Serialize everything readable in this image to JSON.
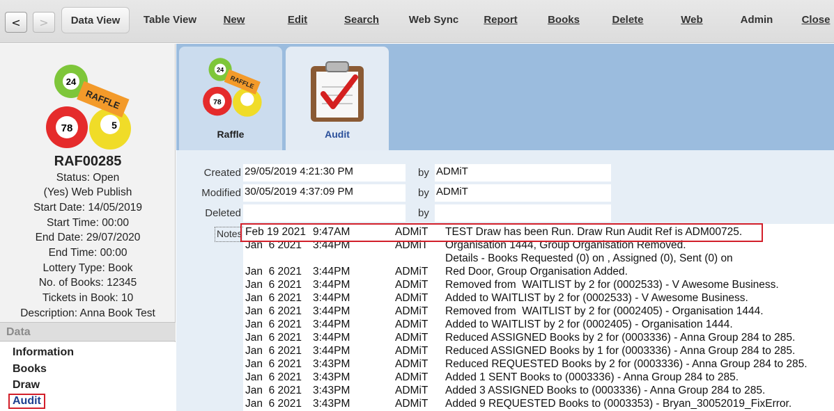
{
  "toolbar": {
    "back_label": "<",
    "forward_label": ">",
    "buttons": [
      "Data View",
      "Table View",
      "New",
      "Edit",
      "Search",
      "Web Sync",
      "Report",
      "Books",
      "Delete",
      "Web",
      "Admin",
      "Close"
    ]
  },
  "record": {
    "id": "RAF00285",
    "details": [
      "Status: Open",
      "(Yes) Web Publish",
      "Start Date: 14/05/2019",
      "Start Time: 00:00",
      "End Date: 29/07/2020",
      "End Time: 00:00",
      "Lottery Type: Book",
      "No. of Books: 12345",
      "Tickets in Book: 10",
      "Description: Anna Book Test"
    ],
    "logo_text": {
      "ball1": "24",
      "ticket": "RAFFLE",
      "ball2": "78",
      "ball3": "5"
    }
  },
  "data_section": {
    "header": "Data",
    "items": [
      "Information",
      "Books",
      "Draw",
      "Audit"
    ]
  },
  "tabs": [
    {
      "label": "Raffle",
      "icon": "raffle-icon"
    },
    {
      "label": "Audit",
      "icon": "clipboard-check-icon"
    }
  ],
  "audit": {
    "created_label": "Created",
    "created_value": "29/05/2019 4:21:30 PM",
    "created_by": "ADMiT",
    "modified_label": "Modified",
    "modified_value": "30/05/2019 4:37:09 PM",
    "modified_by": "ADMiT",
    "deleted_label": "Deleted",
    "deleted_value": "",
    "deleted_by": "",
    "by_label": "by",
    "notes_label": "Notes",
    "notes": [
      {
        "date": "Feb 19 2021",
        "time": "9:47AM",
        "user": "ADMiT",
        "msg": "TEST Draw has been Run. Draw Run Audit Ref is ADM00725."
      },
      {
        "date": "Jan  6 2021",
        "time": "3:44PM",
        "user": "ADMiT",
        "msg": "Organisation 1444, Group Organisation Removed."
      },
      {
        "date": "",
        "time": "",
        "user": "",
        "msg": "Details - Books Requested (0) on , Assigned (0), Sent (0) on"
      },
      {
        "date": "Jan  6 2021",
        "time": "3:44PM",
        "user": "ADMiT",
        "msg": "Red Door, Group Organisation Added."
      },
      {
        "date": "Jan  6 2021",
        "time": "3:44PM",
        "user": "ADMiT",
        "msg": "Removed from  WAITLIST by 2 for (0002533) - V Awesome Business."
      },
      {
        "date": "Jan  6 2021",
        "time": "3:44PM",
        "user": "ADMiT",
        "msg": "Added to WAITLIST by 2 for (0002533) - V Awesome Business."
      },
      {
        "date": "Jan  6 2021",
        "time": "3:44PM",
        "user": "ADMiT",
        "msg": "Removed from  WAITLIST by 2 for (0002405) - Organisation 1444."
      },
      {
        "date": "Jan  6 2021",
        "time": "3:44PM",
        "user": "ADMiT",
        "msg": "Added to WAITLIST by 2 for (0002405) - Organisation 1444."
      },
      {
        "date": "Jan  6 2021",
        "time": "3:44PM",
        "user": "ADMiT",
        "msg": "Reduced ASSIGNED Books by 2 for (0003336) - Anna Group 284 to 285."
      },
      {
        "date": "Jan  6 2021",
        "time": "3:44PM",
        "user": "ADMiT",
        "msg": "Reduced ASSIGNED Books by 1 for (0003336) - Anna Group 284 to 285."
      },
      {
        "date": "Jan  6 2021",
        "time": "3:43PM",
        "user": "ADMiT",
        "msg": "Reduced REQUESTED Books by 2 for (0003336) - Anna Group 284 to 285."
      },
      {
        "date": "Jan  6 2021",
        "time": "3:43PM",
        "user": "ADMiT",
        "msg": "Added 1 SENT Books to (0003336) - Anna Group 284 to 285."
      },
      {
        "date": "Jan  6 2021",
        "time": "3:43PM",
        "user": "ADMiT",
        "msg": "Added 3 ASSIGNED Books to (0003336) - Anna Group 284 to 285."
      },
      {
        "date": "Jan  6 2021",
        "time": "3:43PM",
        "user": "ADMiT",
        "msg": "Added 9 REQUESTED Books to (0003353) - Bryan_30052019_FixError."
      }
    ]
  },
  "colors": {
    "highlight": "#d21f2a",
    "tab_bar": "#9bbcde",
    "link_active": "#1d3f8f"
  }
}
